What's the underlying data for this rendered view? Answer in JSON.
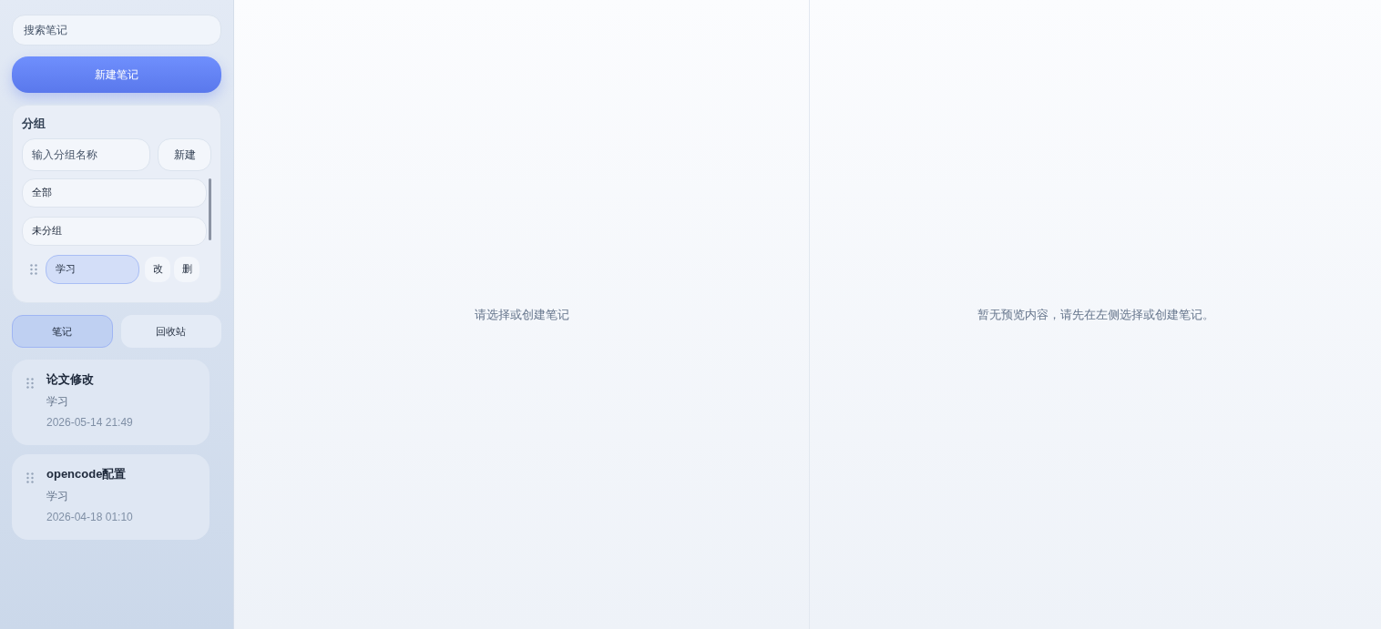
{
  "sidebar": {
    "search": {
      "placeholder": "搜索笔记"
    },
    "new_note_button": "新建笔记",
    "groups": {
      "title": "分组",
      "input": {
        "placeholder": "输入分组名称"
      },
      "create_button": "新建",
      "items": [
        {
          "label": "全部",
          "kind": "builtin",
          "selected": false
        },
        {
          "label": "未分组",
          "kind": "builtin",
          "selected": false
        },
        {
          "label": "学习",
          "kind": "custom",
          "selected": true,
          "edit": "改",
          "delete": "删"
        }
      ]
    },
    "tabs": [
      {
        "label": "笔记",
        "selected": true
      },
      {
        "label": "回收站",
        "selected": false
      }
    ],
    "notes": [
      {
        "title": "论文修改",
        "group": "学习",
        "time": "2026-05-14 21:49"
      },
      {
        "title": "opencode配置",
        "group": "学习",
        "time": "2026-04-18 01:10"
      }
    ]
  },
  "editor": {
    "empty_text": "请选择或创建笔记"
  },
  "preview": {
    "empty_text": "暂无预览内容，请先在左侧选择或创建笔记。"
  }
}
